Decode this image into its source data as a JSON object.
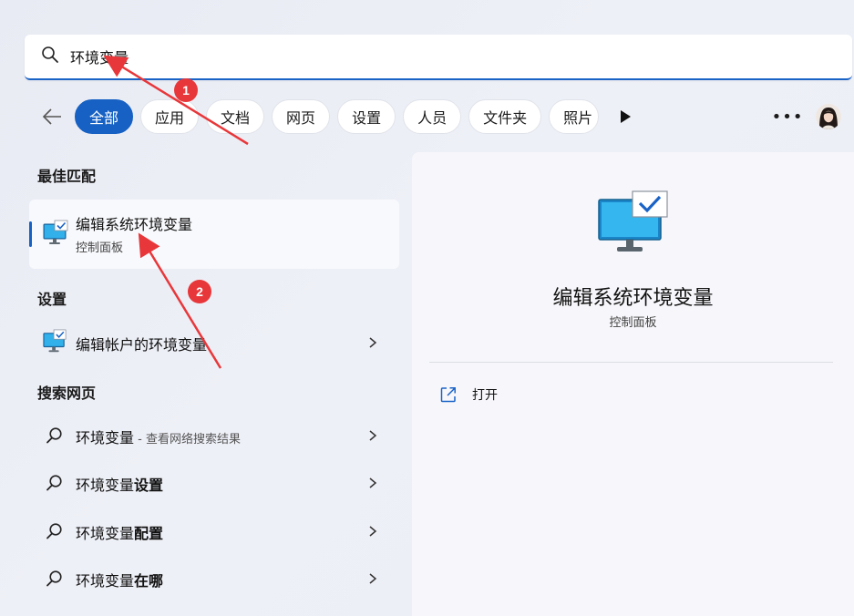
{
  "search": {
    "query": "环境变量"
  },
  "filters": {
    "chips": [
      {
        "label": "全部",
        "active": true
      },
      {
        "label": "应用",
        "active": false
      },
      {
        "label": "文档",
        "active": false
      },
      {
        "label": "网页",
        "active": false
      },
      {
        "label": "设置",
        "active": false
      },
      {
        "label": "人员",
        "active": false
      },
      {
        "label": "文件夹",
        "active": false
      },
      {
        "label": "照片",
        "active": false
      }
    ],
    "more_label": "•••"
  },
  "sections": {
    "best_match": "最佳匹配",
    "settings": "设置",
    "web": "搜索网页"
  },
  "best_match": {
    "title": "编辑系统环境变量",
    "subtitle": "控制面板",
    "icon": "monitor-check-icon"
  },
  "settings_results": [
    {
      "label": "编辑帐户的环境变量",
      "icon": "monitor-check-icon"
    }
  ],
  "web_results": [
    {
      "prefix": "环境变量",
      "bold": "",
      "hint": " - 查看网络搜索结果"
    },
    {
      "prefix": "环境变量",
      "bold": "设置",
      "hint": ""
    },
    {
      "prefix": "环境变量",
      "bold": "配置",
      "hint": ""
    },
    {
      "prefix": "环境变量",
      "bold": "在哪",
      "hint": ""
    }
  ],
  "detail": {
    "title": "编辑系统环境变量",
    "subtitle": "控制面板",
    "open_label": "打开"
  },
  "annotations": {
    "badge1": "1",
    "badge2": "2",
    "color": "#e8373a"
  },
  "colors": {
    "accent": "#1661c3",
    "annotation": "#e8373a"
  }
}
